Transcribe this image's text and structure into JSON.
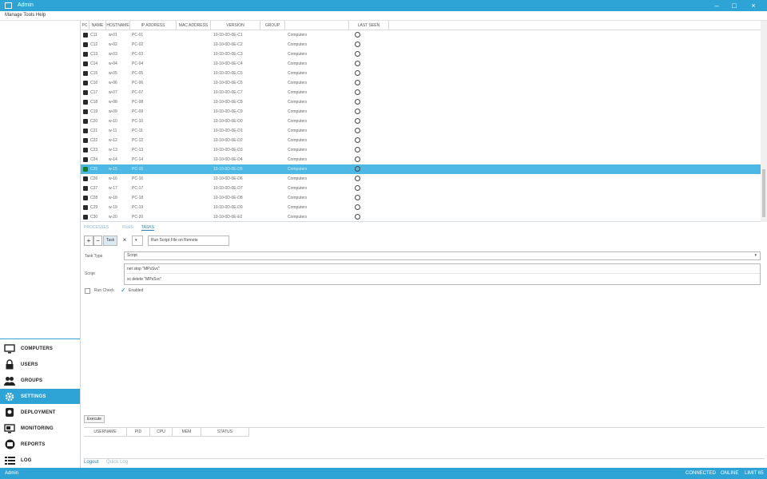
{
  "window": {
    "title": "Admin"
  },
  "menu": {
    "text": "Manage Tools Help"
  },
  "columns": [
    "PC",
    "NAME",
    "HOSTNAME",
    "IP ADDRESS",
    "MAC ADDRESS",
    "VERSION",
    "GROUP",
    "",
    "LAST SEEN"
  ],
  "rows": [
    [
      "C11",
      "w-01",
      "PC-01",
      "",
      "10-10-0D-0E-C1",
      "",
      "Computers"
    ],
    [
      "C12",
      "w-02",
      "PC-02",
      "",
      "10-10-0D-0E-C2",
      "",
      "Computers"
    ],
    [
      "C13",
      "w-03",
      "PC-03",
      "",
      "10-10-0D-0E-C3",
      "",
      "Computers"
    ],
    [
      "C14",
      "w-04",
      "PC-04",
      "",
      "10-10-0D-0E-C4",
      "",
      "Computers"
    ],
    [
      "C15",
      "w-05",
      "PC-05",
      "",
      "10-10-0D-0E-C5",
      "",
      "Computers"
    ],
    [
      "C16",
      "w-06",
      "PC-06",
      "",
      "10-10-0D-0E-C6",
      "",
      "Computers"
    ],
    [
      "C17",
      "w-07",
      "PC-07",
      "",
      "10-10-0D-0E-C7",
      "",
      "Computers"
    ],
    [
      "C18",
      "w-08",
      "PC-08",
      "",
      "10-10-0D-0E-C8",
      "",
      "Computers"
    ],
    [
      "C19",
      "w-09",
      "PC-09",
      "",
      "10-10-0D-0E-C9",
      "",
      "Computers"
    ],
    [
      "C20",
      "w-10",
      "PC-10",
      "",
      "10-10-0D-0E-D0",
      "",
      "Computers"
    ],
    [
      "C21",
      "w-11",
      "PC-11",
      "",
      "10-10-0D-0E-D1",
      "",
      "Computers"
    ],
    [
      "C22",
      "w-12",
      "PC-12",
      "",
      "10-10-0D-0E-D2",
      "",
      "Computers"
    ],
    [
      "C23",
      "w-13",
      "PC-13",
      "",
      "10-10-0D-0E-D3",
      "",
      "Computers"
    ],
    [
      "C24",
      "w-14",
      "PC-14",
      "",
      "10-10-0D-0E-D4",
      "",
      "Computers"
    ],
    [
      "C25",
      "w-15",
      "PC-15",
      "",
      "10-10-0D-0E-D5",
      "",
      "Computers"
    ],
    [
      "C26",
      "w-16",
      "PC-16",
      "",
      "10-10-0D-0E-D6",
      "",
      "Computers"
    ],
    [
      "C27",
      "w-17",
      "PC-17",
      "",
      "10-10-0D-0E-D7",
      "",
      "Computers"
    ],
    [
      "C28",
      "w-18",
      "PC-18",
      "",
      "10-10-0D-0E-D8",
      "",
      "Computers"
    ],
    [
      "C29",
      "w-19",
      "PC-19",
      "",
      "10-10-0D-0E-D9",
      "",
      "Computers"
    ],
    [
      "C30",
      "w-20",
      "PC-20",
      "",
      "10-10-0D-0E-E0",
      "",
      "Computers"
    ]
  ],
  "selected_row": 14,
  "tabs": [
    "PROCESSES",
    "FILES",
    "TASKS"
  ],
  "active_tab": 2,
  "toolbar": {
    "add": "+",
    "remove": "−",
    "task_select": "Task",
    "close": "×",
    "template": "Run Script File on Remote"
  },
  "form": {
    "type_label": "Task Type",
    "type_value": "Script",
    "script_label": "Script",
    "script_line1": "net stop \"MPsSvc\"",
    "script_line2": "sc delete \"MPsSvc\"",
    "run_label": "Run Check",
    "run_value": "Enabled"
  },
  "execute_label": "Execute",
  "results_columns": [
    "USERNAME",
    "PID",
    "CPU",
    "MEM",
    "STATUS"
  ],
  "nav": [
    {
      "label": "COMPUTERS",
      "icon": "monitor-icon"
    },
    {
      "label": "USERS",
      "icon": "lock-icon"
    },
    {
      "label": "GROUPS",
      "icon": "users-icon"
    },
    {
      "label": "SETTINGS",
      "icon": "gear-icon"
    },
    {
      "label": "DEPLOYMENT",
      "icon": "deploy-icon"
    },
    {
      "label": "MONITORING",
      "icon": "monitor-screen-icon"
    },
    {
      "label": "REPORTS",
      "icon": "report-icon"
    },
    {
      "label": "LOG",
      "icon": "list-icon"
    }
  ],
  "active_nav": 3,
  "bottom_links": [
    "Logout",
    "Quick Log"
  ],
  "status": {
    "left": "Admin",
    "right1": "CONNECTED",
    "right2": "ONLINE",
    "right3": "LIMIT 65"
  },
  "colors": {
    "accent": "#2ea3d6",
    "selected_row": "#4db8e3"
  }
}
